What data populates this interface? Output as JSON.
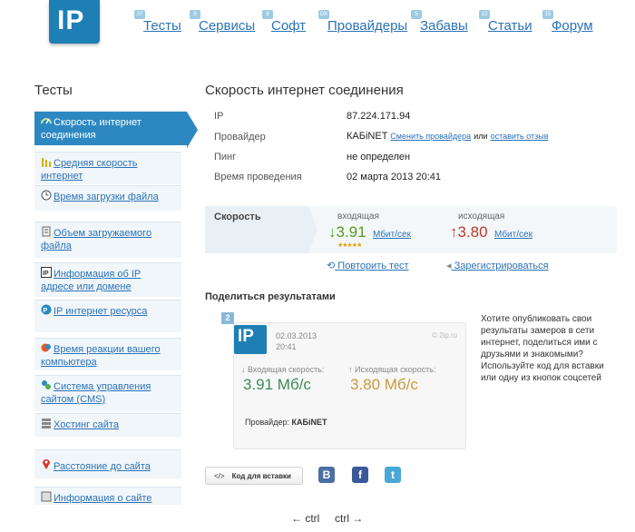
{
  "header": {
    "logo_text": "IP",
    "nav": [
      {
        "badge": "37",
        "label": "Тесты"
      },
      {
        "badge": "9",
        "label": "Сервисы"
      },
      {
        "badge": "8",
        "label": "Софт"
      },
      {
        "badge": "OK",
        "label": "Провайдеры"
      },
      {
        "badge": "5",
        "label": "Забавы"
      },
      {
        "badge": "12",
        "label": "Статьи"
      },
      {
        "badge": "15",
        "label": "Форум"
      }
    ]
  },
  "sidebar": {
    "title": "Тесты",
    "items": [
      {
        "label": "Скорость интернет соединения",
        "icon": "speed-icon"
      },
      {
        "label": "Средняя скорость интернет",
        "icon": "bars-icon"
      },
      {
        "label": "Время загрузки файла",
        "icon": "clock-icon"
      },
      {
        "label": "Объем загружаемого файла",
        "icon": "file-icon"
      },
      {
        "label": "Информация об IP адресе или домене",
        "icon": "ip-icon"
      },
      {
        "label": "IP интернет ресурса",
        "icon": "globe-ip-icon"
      },
      {
        "label": "Время реакции вашего компьютера",
        "icon": "reaction-icon"
      },
      {
        "label": "Система управления сайтом (CMS)",
        "icon": "cms-icon"
      },
      {
        "label": "Хостинг сайта",
        "icon": "hosting-icon"
      },
      {
        "label": "Расстояние до сайта",
        "icon": "pin-icon"
      },
      {
        "label": "Информация о сайте",
        "icon": "info-icon"
      }
    ]
  },
  "main": {
    "title": "Скорость интернет соединения",
    "info": [
      {
        "key": "IP",
        "value": "87.224.171.94"
      },
      {
        "key": "Провайдер",
        "value": "КАБiNET"
      },
      {
        "key": "Пинг",
        "value": "не определен"
      },
      {
        "key": "Время проведения",
        "value": "02 марта 2013 20:41"
      }
    ],
    "change_provider": "Сменить провайдера",
    "or_text": "или",
    "leave_review": "оставить отзыв",
    "speed": {
      "label": "Скорость",
      "in_caption": "входящая",
      "in_value": "3.91",
      "in_unit": "Мбит/сек",
      "in_color": "#5a9a1e",
      "out_caption": "исходящая",
      "out_value": "3.80",
      "out_unit": "Мбит/сек",
      "out_color": "#c0392b",
      "stars": "★★★★★"
    },
    "repeat_test": "Повторить тест",
    "register": "Зарегистрироваться"
  },
  "share": {
    "title": "Поделиться результатами",
    "badge": "2",
    "card_logo": "IP",
    "card_date": "02.03.2013",
    "card_time": "20:41",
    "card_site": "© 2ip.ru",
    "in_caption": "↓ Входящая скорость:",
    "in_value": "3.91 Мб/с",
    "out_caption": "↑ Исходящая скорость:",
    "out_value": "3.80 Мб/с",
    "provider_label": "Провайдер:",
    "provider_value": "КАБiNET",
    "description": "Хотите опубликовать свои результаты замеров в сети интернет, поделиться ими с друзьями и знакомыми? Используйте код для вставки или одну из кнопок соцсетей",
    "code_button": "Код для вставки",
    "code_icon_text": "</>",
    "social": [
      {
        "letter": "B",
        "color": "#4a6fa5",
        "icon": "vk-icon"
      },
      {
        "letter": "f",
        "color": "#3b5998",
        "icon": "facebook-icon"
      },
      {
        "letter": "t",
        "color": "#4aa8d8",
        "icon": "twitter-icon"
      }
    ]
  },
  "footer": {
    "prev": "← ctrl",
    "next": "ctrl →"
  }
}
